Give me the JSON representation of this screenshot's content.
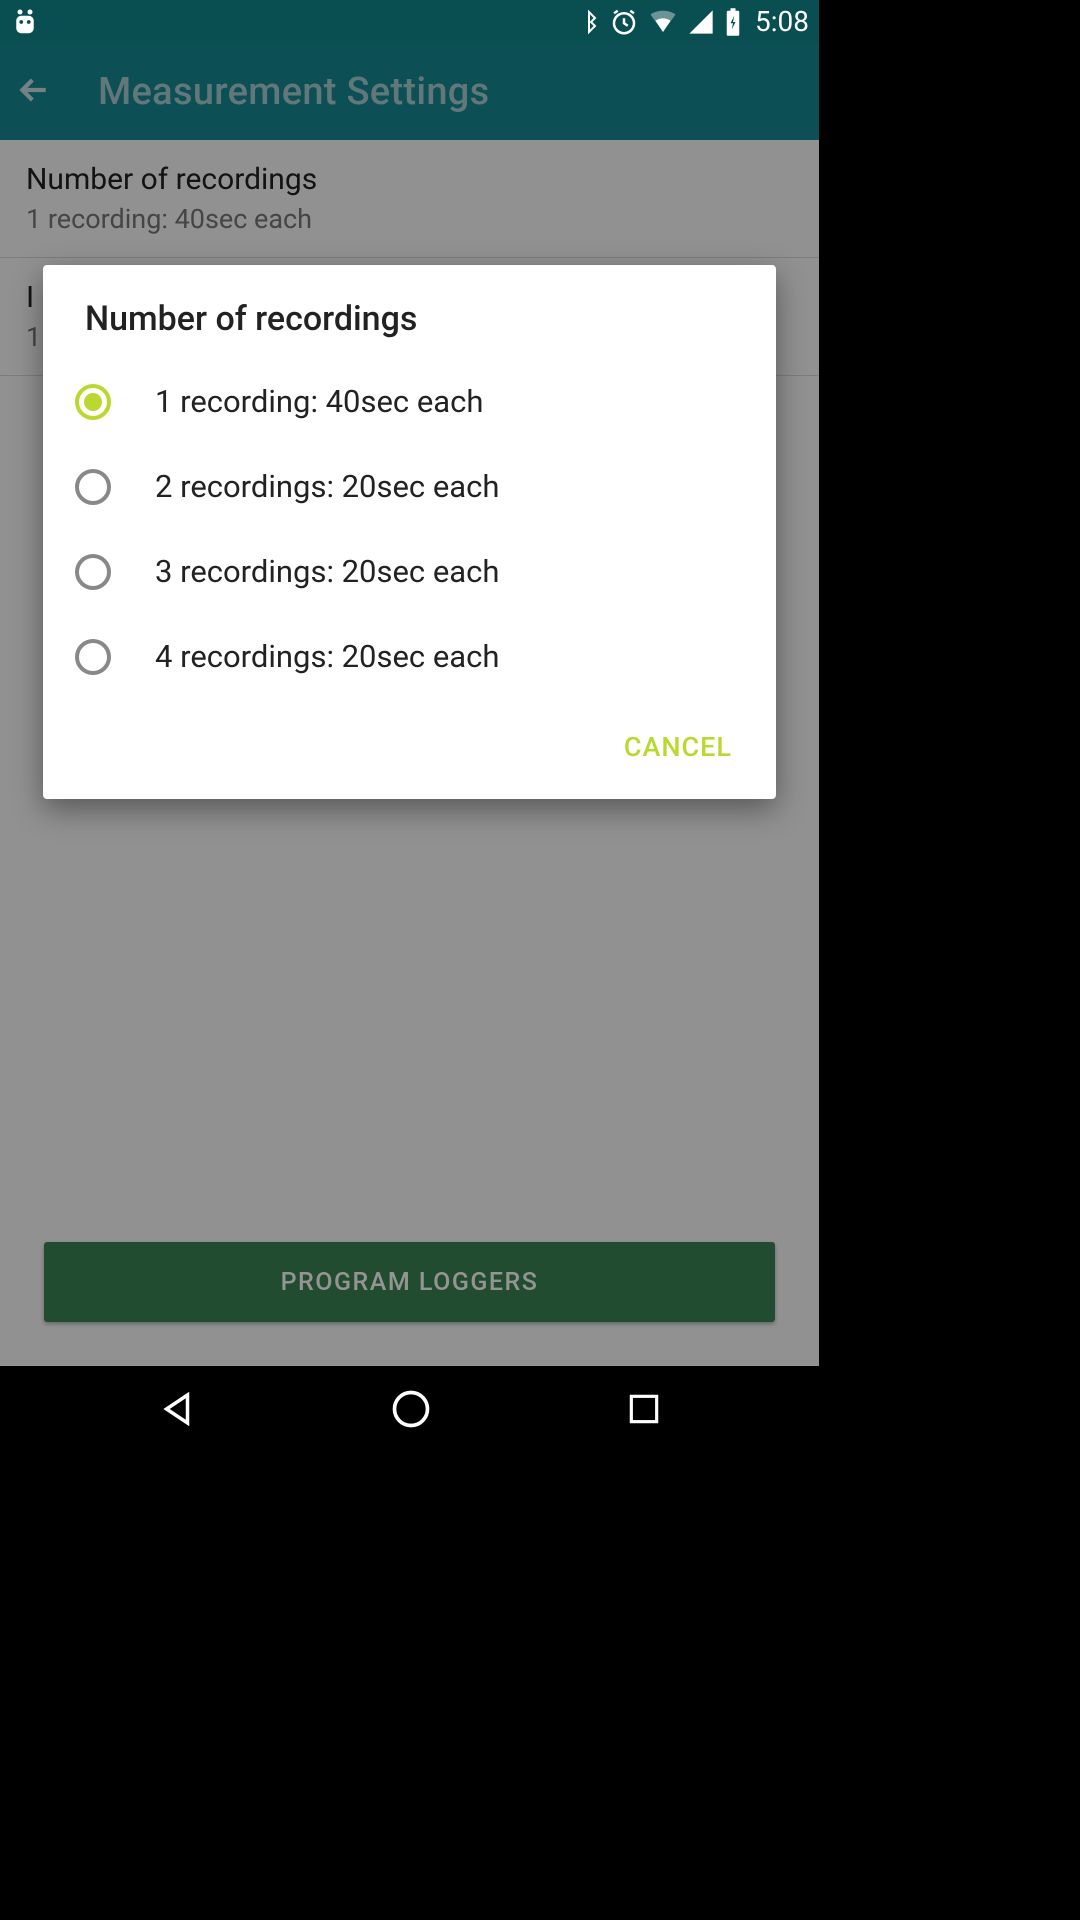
{
  "status_bar": {
    "time": "5:08"
  },
  "app_bar": {
    "title": "Measurement Settings"
  },
  "settings": {
    "recordings": {
      "title": "Number of recordings",
      "subtitle": "1 recording: 40sec each"
    },
    "interval": {
      "title": "I",
      "subtitle": "1"
    }
  },
  "program_button": "PROGRAM LOGGERS",
  "dialog": {
    "title": "Number of recordings",
    "options": [
      {
        "label": "1 recording: 40sec each",
        "selected": true
      },
      {
        "label": "2 recordings: 20sec each",
        "selected": false
      },
      {
        "label": "3 recordings: 20sec each",
        "selected": false
      },
      {
        "label": "4 recordings: 20sec each",
        "selected": false
      }
    ],
    "cancel": "CANCEL"
  }
}
